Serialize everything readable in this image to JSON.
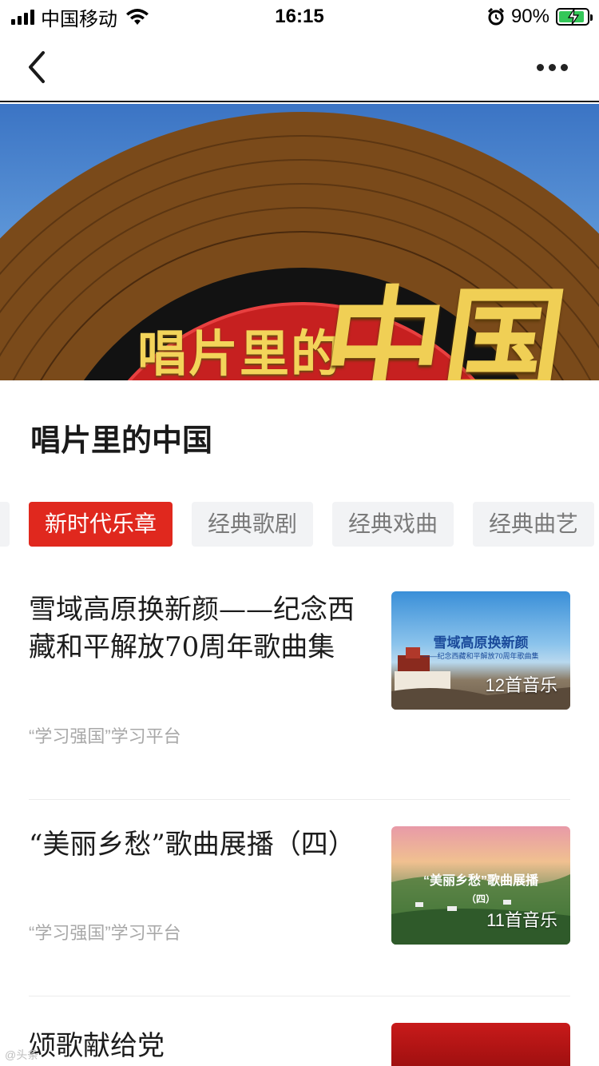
{
  "status_bar": {
    "carrier": "中国移动",
    "time": "16:15",
    "battery_percent": "90%",
    "battery_level": 0.9,
    "icons": [
      "signal-icon",
      "wifi-icon",
      "alarm-icon",
      "battery-icon"
    ]
  },
  "nav": {
    "back_icon": "chevron-left-icon",
    "more_icon": "more-dots-icon"
  },
  "banner": {
    "title": "唱片里的",
    "calligraphy": "中国"
  },
  "page_title": "唱片里的中国",
  "tabs": [
    {
      "label": "新时代乐章",
      "active": true
    },
    {
      "label": "经典歌剧",
      "active": false
    },
    {
      "label": "经典戏曲",
      "active": false
    },
    {
      "label": "经典曲艺",
      "active": false
    }
  ],
  "articles": [
    {
      "title": "雪域高原换新颜——纪念西藏和平解放70周年歌曲集",
      "source": "“学习强国”学习平台",
      "thumb_title": "雪域高原换新颜",
      "thumb_subtitle": "——纪念西藏和平解放70周年歌曲集",
      "thumb_count": "12首音乐"
    },
    {
      "title": "“美丽乡愁”歌曲展播（四）",
      "source": "“学习强国”学习平台",
      "thumb_title": "“美丽乡愁”歌曲展播",
      "thumb_subtitle": "（四）",
      "thumb_count": "11首音乐"
    },
    {
      "title": "颂歌献给党",
      "source": "",
      "thumb_title": "",
      "thumb_subtitle": "",
      "thumb_count": ""
    }
  ],
  "watermark": "@头条"
}
